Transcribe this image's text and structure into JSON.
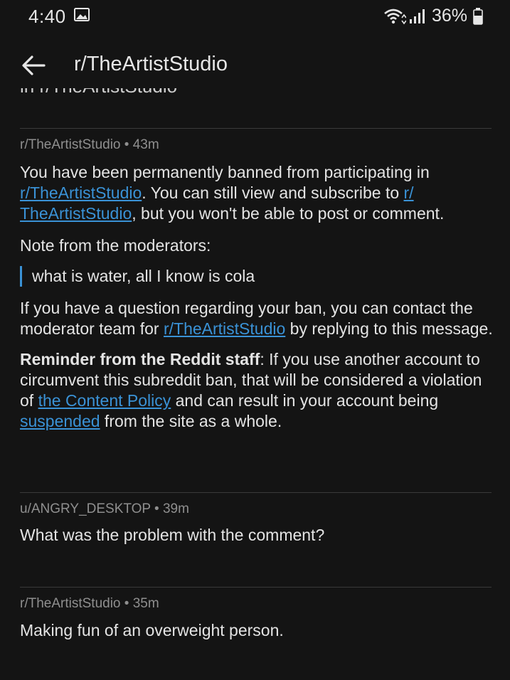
{
  "status_bar": {
    "time": "4:40",
    "battery_percent": "36%"
  },
  "app_bar": {
    "title": "r/TheArtistStudio"
  },
  "cut_heading": "in r/TheArtistStudio",
  "messages": [
    {
      "meta": "r/TheArtistStudio • 43m",
      "ban_text_pre": "You have been permanently banned from participating in ",
      "ban_link_1": "r/TheArtistStudio",
      "ban_text_mid": ". You can still view and subscribe to ",
      "ban_link_2a": "r/",
      "ban_link_2b": "TheArtistStudio",
      "ban_text_post": ", but you won't be able to post or comment.",
      "note_label": "Note from the moderators:",
      "quote": "what is water, all I know is cola",
      "question_pre": "If you have a question regarding your ban, you can contact the moderator team for ",
      "question_link": "r/TheArtistStudio",
      "question_post": " by replying to this message.",
      "reminder_bold": "Reminder from the Reddit staff",
      "reminder_pre": ": If you use another account to circumvent this subreddit ban, that will be considered a violation of ",
      "reminder_link_1": "the Content Policy",
      "reminder_mid": " and can result in your account being ",
      "reminder_link_2": "suspended",
      "reminder_post": " from the site as a whole."
    },
    {
      "meta": "u/ANGRY_DESKTOP • 39m",
      "body": "What was the problem with the comment?"
    },
    {
      "meta": "r/TheArtistStudio • 35m",
      "body": "Making fun of an overweight person."
    }
  ]
}
